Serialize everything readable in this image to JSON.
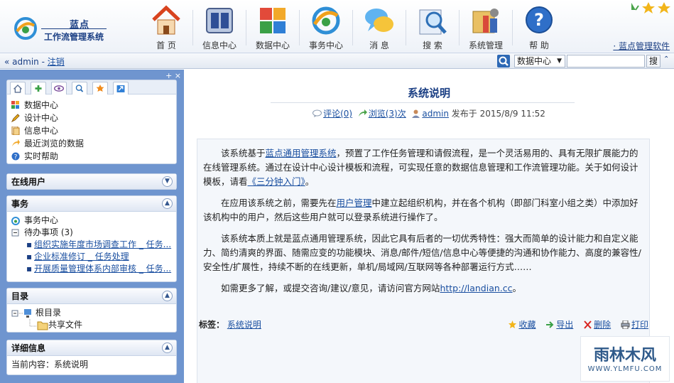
{
  "app": {
    "brand_top": "蓝点",
    "brand_bottom": "工作流管理系统",
    "company_link": "· 蓝点管理软件"
  },
  "nav": [
    {
      "label": "首 页",
      "icon": "home-icon"
    },
    {
      "label": "信息中心",
      "icon": "info-center-icon"
    },
    {
      "label": "数据中心",
      "icon": "data-center-icon"
    },
    {
      "label": "事务中心",
      "icon": "task-center-icon"
    },
    {
      "label": "消 息",
      "icon": "message-icon"
    },
    {
      "label": "搜 索",
      "icon": "search-icon"
    },
    {
      "label": "系统管理",
      "icon": "system-admin-icon"
    },
    {
      "label": "帮 助",
      "icon": "help-icon"
    }
  ],
  "userbar": {
    "prefix": "«",
    "user": "admin",
    "sep": " - ",
    "logout": "注销"
  },
  "search": {
    "scope": "数据中心",
    "button": "搜",
    "collapse": "⌃"
  },
  "sidebar": {
    "controls": "+ ×",
    "quick_items": [
      {
        "label": "数据中心",
        "icon": "grid-icon"
      },
      {
        "label": "设计中心",
        "icon": "pencil-icon"
      },
      {
        "label": "信息中心",
        "icon": "document-icon"
      },
      {
        "label": "最近浏览的数据",
        "icon": "arrow-icon"
      },
      {
        "label": "实时帮助",
        "icon": "help-icon"
      }
    ],
    "panels": {
      "online": {
        "title": "在线用户"
      },
      "tasks": {
        "title": "事务",
        "center": "事务中心",
        "todo": "待办事项 (3)",
        "items": [
          "组织实施年度市场调查工作 _ 任务...",
          "企业标准修订 _ 任务处理",
          "开展质量管理体系内部审核 _ 任务..."
        ]
      },
      "catalog": {
        "title": "目录",
        "root": "根目录",
        "shared": "共享文件"
      },
      "detail": {
        "title": "详细信息",
        "current": "当前内容：系统说明"
      }
    }
  },
  "article": {
    "title": "系统说明",
    "comments": "评论(0)",
    "views": "浏览(3)次",
    "author": "admin",
    "published": "发布于 2015/8/9 11:52",
    "p1_a": "该系统基于",
    "p1_link": "蓝点通用管理系统",
    "p1_b": "，预置了工作任务管理和请假流程，是一个灵活易用的、具有无限扩展能力的在线管理系统。通过在设计中心设计模板和流程，可实现任意的数据信息管理和工作流管理功能。关于如何设计模板，请看",
    "p1_link2": "《三分钟入门》",
    "p1_c": "。",
    "p2_a": "在应用该系统之前，需要先在",
    "p2_link": "用户管理",
    "p2_b": "中建立起组织机构，并在各个机构（即部门科室小组之类）中添加好该机构中的用户，然后这些用户就可以登录系统进行操作了。",
    "p3": "该系统本质上就是蓝点通用管理系统，因此它具有后者的一切优秀特性：强大而简单的设计能力和自定义能力、简约清爽的界面、随需应变的功能模块、消息/邮件/短信/信息中心等便捷的沟通和协作能力、高度的兼容性/安全性/扩展性，持续不断的在线更新，单机/局域网/互联网等各种部署运行方式……",
    "p4_a": "如需更多了解，或提交咨询/建议/意见，请访问官方网站",
    "p4_link": "http://landian.cc",
    "p4_b": "。",
    "tag_label": "标签：",
    "tag": "系统说明",
    "actions": {
      "favorite": "收藏",
      "export": "导出",
      "delete": "删除",
      "print": "打印"
    }
  },
  "watermark": {
    "top": "雨林木风",
    "bottom": "WWW.YLMFU.COM"
  }
}
